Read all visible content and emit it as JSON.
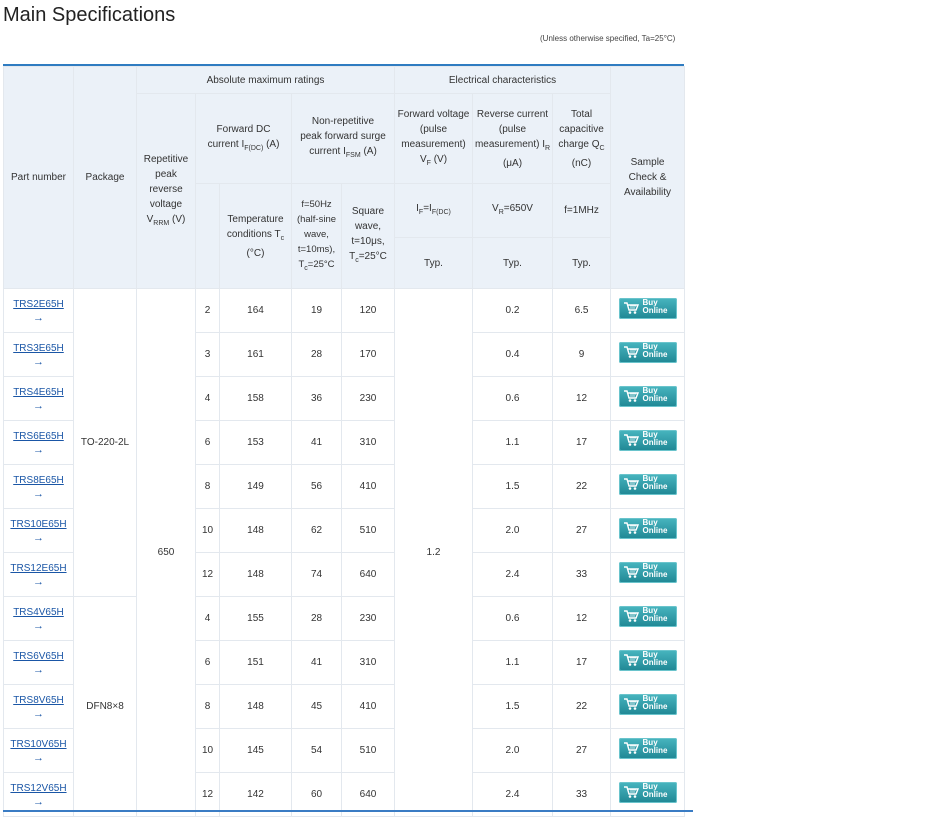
{
  "page": {
    "title": "Main Specifications",
    "note": "(Unless otherwise specified, Ta=25°C)"
  },
  "headers": {
    "part_number": "Part number",
    "package": "Package",
    "abs_max": "Absolute maximum ratings",
    "elec_char": "Electrical characteristics",
    "vrrm": "Repetitive peak reverse voltage V",
    "vrrm_sub": "RRM",
    "vrrm_unit": " (V)",
    "fwd_dc": "Forward DC current I",
    "fwd_dc_sub": "F(DC)",
    "fwd_dc_unit": " (A)",
    "ifsm": "Non-repetitive peak forward surge current I",
    "ifsm_sub": "FSM",
    "ifsm_unit": " (A)",
    "fwd_v": "Forward voltage (pulse measurement) V",
    "fwd_v_sub": "F",
    "fwd_v_unit": " (V)",
    "rev_i": "Reverse current (pulse measurement) I",
    "rev_i_sub": "R",
    "rev_i_unit": " (μA)",
    "qc": "Total capacitive charge Q",
    "qc_sub": "C",
    "qc_unit": " (nC)",
    "sample": "Sample Check & Availability",
    "temp_cond": "Temperature conditions T",
    "temp_cond_sub": "c",
    "temp_cond_unit": " (°C)",
    "half_sine": "f=50Hz (half-sine wave, t=10ms), T",
    "half_sine_sub": "c",
    "half_sine_unit": "=25°C",
    "square": "Square wave, t=10μs, T",
    "square_sub": "c",
    "square_unit": "=25°C",
    "cond_if": "I",
    "cond_if_sub1": "F",
    "cond_if_mid": "=I",
    "cond_if_sub2": "F(DC)",
    "cond_vr": "V",
    "cond_vr_sub": "R",
    "cond_vr_rest": "=650V",
    "cond_f": "f=1MHz",
    "typ": "Typ."
  },
  "shared": {
    "vrrm": "650",
    "vf": "1.2",
    "pkg_a": "TO-220-2L",
    "pkg_b": "DFN8×8",
    "arrow": "→",
    "buy_line1": "Buy",
    "buy_line2": "Online"
  },
  "rows": [
    {
      "part": "TRS2E65H",
      "if": "2",
      "tc": "164",
      "ifsm_sine": "19",
      "ifsm_sq": "120",
      "ir": "0.2",
      "qc": "6.5"
    },
    {
      "part": "TRS3E65H",
      "if": "3",
      "tc": "161",
      "ifsm_sine": "28",
      "ifsm_sq": "170",
      "ir": "0.4",
      "qc": "9"
    },
    {
      "part": "TRS4E65H",
      "if": "4",
      "tc": "158",
      "ifsm_sine": "36",
      "ifsm_sq": "230",
      "ir": "0.6",
      "qc": "12"
    },
    {
      "part": "TRS6E65H",
      "if": "6",
      "tc": "153",
      "ifsm_sine": "41",
      "ifsm_sq": "310",
      "ir": "1.1",
      "qc": "17"
    },
    {
      "part": "TRS8E65H",
      "if": "8",
      "tc": "149",
      "ifsm_sine": "56",
      "ifsm_sq": "410",
      "ir": "1.5",
      "qc": "22"
    },
    {
      "part": "TRS10E65H",
      "if": "10",
      "tc": "148",
      "ifsm_sine": "62",
      "ifsm_sq": "510",
      "ir": "2.0",
      "qc": "27"
    },
    {
      "part": "TRS12E65H",
      "if": "12",
      "tc": "148",
      "ifsm_sine": "74",
      "ifsm_sq": "640",
      "ir": "2.4",
      "qc": "33"
    },
    {
      "part": "TRS4V65H",
      "if": "4",
      "tc": "155",
      "ifsm_sine": "28",
      "ifsm_sq": "230",
      "ir": "0.6",
      "qc": "12"
    },
    {
      "part": "TRS6V65H",
      "if": "6",
      "tc": "151",
      "ifsm_sine": "41",
      "ifsm_sq": "310",
      "ir": "1.1",
      "qc": "17"
    },
    {
      "part": "TRS8V65H",
      "if": "8",
      "tc": "148",
      "ifsm_sine": "45",
      "ifsm_sq": "410",
      "ir": "1.5",
      "qc": "22"
    },
    {
      "part": "TRS10V65H",
      "if": "10",
      "tc": "145",
      "ifsm_sine": "54",
      "ifsm_sq": "510",
      "ir": "2.0",
      "qc": "27"
    },
    {
      "part": "TRS12V65H",
      "if": "12",
      "tc": "142",
      "ifsm_sine": "60",
      "ifsm_sq": "640",
      "ir": "2.4",
      "qc": "33"
    }
  ]
}
